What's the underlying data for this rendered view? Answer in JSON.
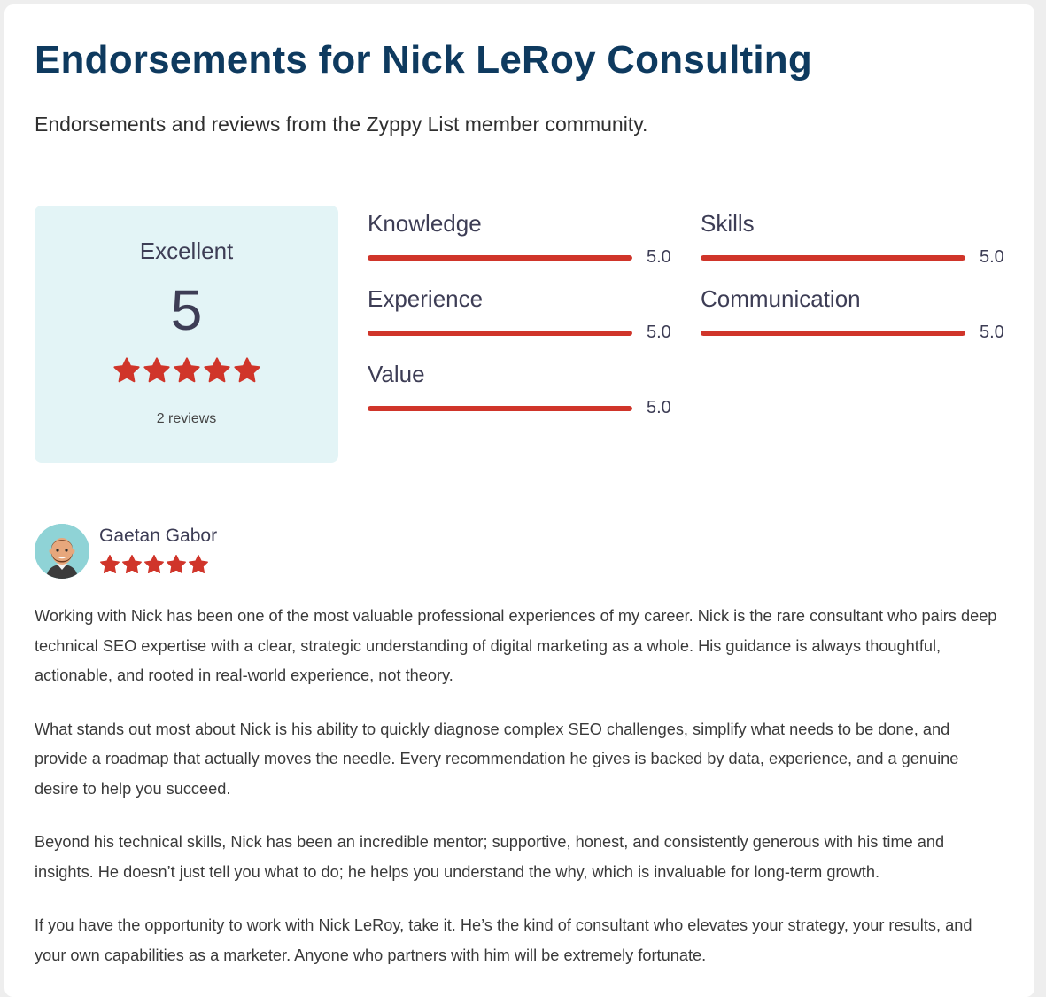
{
  "header": {
    "title": "Endorsements for Nick LeRoy Consulting",
    "subtitle": "Endorsements and reviews from the Zyppy List member community."
  },
  "summary": {
    "rating_label": "Excellent",
    "score": "5",
    "stars": 5,
    "review_count": "2 reviews"
  },
  "metrics": [
    {
      "label": "Knowledge",
      "value": "5.0",
      "fraction": 1.0
    },
    {
      "label": "Skills",
      "value": "5.0",
      "fraction": 1.0
    },
    {
      "label": "Experience",
      "value": "5.0",
      "fraction": 1.0
    },
    {
      "label": "Communication",
      "value": "5.0",
      "fraction": 1.0
    },
    {
      "label": "Value",
      "value": "5.0",
      "fraction": 1.0
    }
  ],
  "review": {
    "reviewer_name": "Gaetan Gabor",
    "stars": 5,
    "paragraphs": [
      "Working with Nick has been one of the most valuable professional experiences of my career. Nick is the rare consultant who pairs deep technical SEO expertise with a clear, strategic understanding of digital marketing as a whole. His guidance is always thoughtful, actionable, and rooted in real-world experience, not theory.",
      "What stands out most about Nick is his ability to quickly diagnose complex SEO challenges, simplify what needs to be done, and provide a roadmap that actually moves the needle. Every recommendation he gives is backed by data, experience, and a genuine desire to help you succeed.",
      "Beyond his technical skills, Nick has been an incredible mentor; supportive, honest, and consistently generous with his time and insights. He doesn’t just tell you what to do; he helps you understand the why, which is invaluable for long-term growth.",
      "If you have the opportunity to work with Nick LeRoy, take it. He’s the kind of consultant who elevates your strategy, your results, and your own capabilities as a marketer. Anyone who partners with him will be extremely fortunate."
    ]
  },
  "colors": {
    "title": "#0e3a5f",
    "star": "#d0352a",
    "bar": "#d0352a",
    "summary_bg": "#e3f4f6",
    "avatar_bg": "#8fd3d6"
  }
}
